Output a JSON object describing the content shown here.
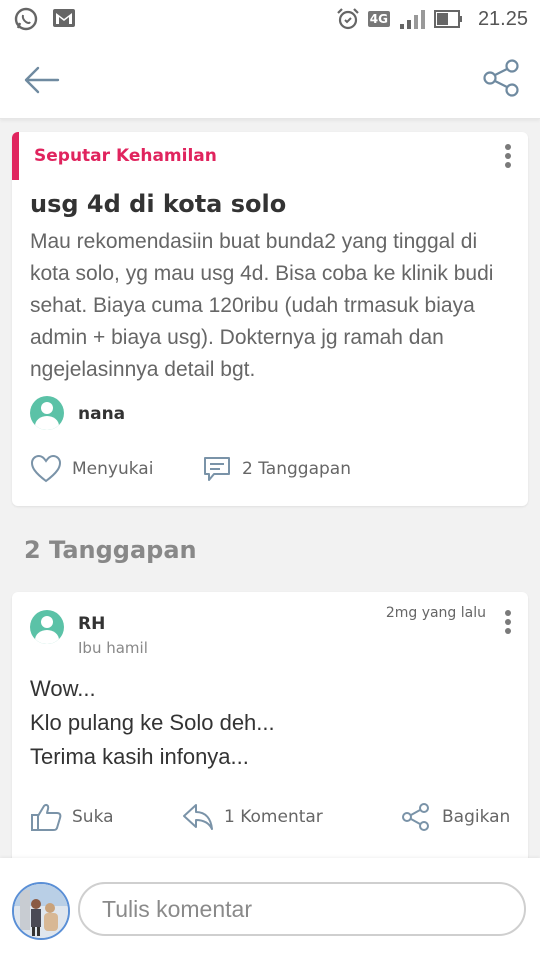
{
  "status_bar": {
    "time": "21.25",
    "network": "4G",
    "icons": [
      "whatsapp-icon",
      "gmail-icon",
      "alarm-icon",
      "signal-icon",
      "battery-icon"
    ]
  },
  "app_bar": {
    "icons": [
      "back-arrow-icon",
      "share-icon"
    ]
  },
  "post": {
    "category": "Seputar Kehamilan",
    "title": "usg 4d di kota solo",
    "body": "Mau rekomendasiin buat bunda2 yang tinggal di kota solo, yg mau usg 4d. Bisa coba ke klinik budi sehat. Biaya cuma 120ribu (udah trmasuk biaya admin + biaya usg). Dokternya jg ramah dan ngejelasinnya detail bgt.",
    "author": "nana",
    "like_label": "Menyukai",
    "responses_label": "2 Tanggapan"
  },
  "responses_section": {
    "title": "2 Tanggapan"
  },
  "reply": {
    "name": "RH",
    "role": "Ibu hamil",
    "time": "2mg yang lalu",
    "lines": [
      "Wow...",
      "Klo pulang ke Solo deh...",
      "Terima kasih infonya..."
    ],
    "like_label": "Suka",
    "comment_label": "1 Komentar",
    "share_label": "Bagikan"
  },
  "comment_bar": {
    "placeholder": "Tulis komentar"
  },
  "colors": {
    "accent": "#e0245e",
    "avatar": "#5bc2a7",
    "icon": "#7a93a8"
  }
}
